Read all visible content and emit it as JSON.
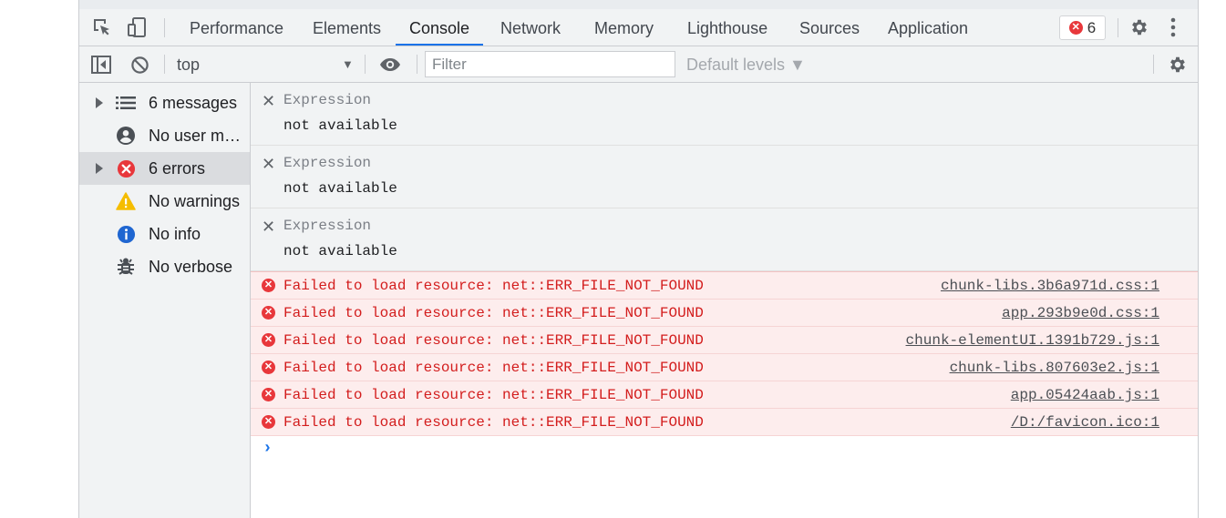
{
  "tabs": [
    {
      "label": "Performance"
    },
    {
      "label": "Elements"
    },
    {
      "label": "Console"
    },
    {
      "label": "Network"
    },
    {
      "label": "Memory"
    },
    {
      "label": "Lighthouse"
    },
    {
      "label": "Sources"
    },
    {
      "label": "Application"
    }
  ],
  "header": {
    "error_count": "6",
    "inspect_icon": "inspect-element-icon",
    "device_icon": "device-toolbar-icon",
    "settings_icon": "gear-icon",
    "more_icon": "kebab-menu-icon"
  },
  "toolbar": {
    "context": "top",
    "filter_placeholder": "Filter",
    "levels": "Default levels ▼"
  },
  "sidebar": {
    "items": [
      {
        "label": "6 messages",
        "icon": "list-icon",
        "expandable": true
      },
      {
        "label": "No user me...",
        "icon": "user-icon",
        "expandable": false
      },
      {
        "label": "6 errors",
        "icon": "error-icon",
        "expandable": true,
        "selected": true
      },
      {
        "label": "No warnings",
        "icon": "warning-icon",
        "expandable": false
      },
      {
        "label": "No info",
        "icon": "info-icon",
        "expandable": false
      },
      {
        "label": "No verbose",
        "icon": "bug-icon",
        "expandable": false
      }
    ]
  },
  "expressions": [
    {
      "name": "Expression",
      "value": "not available"
    },
    {
      "name": "Expression",
      "value": "not available"
    },
    {
      "name": "Expression",
      "value": "not available"
    }
  ],
  "errors": [
    {
      "message": "Failed to load resource: net::ERR_FILE_NOT_FOUND",
      "source": "chunk-libs.3b6a971d.css:1"
    },
    {
      "message": "Failed to load resource: net::ERR_FILE_NOT_FOUND",
      "source": "app.293b9e0d.css:1"
    },
    {
      "message": "Failed to load resource: net::ERR_FILE_NOT_FOUND",
      "source": "chunk-elementUI.1391b729.js:1"
    },
    {
      "message": "Failed to load resource: net::ERR_FILE_NOT_FOUND",
      "source": "chunk-libs.807603e2.js:1"
    },
    {
      "message": "Failed to load resource: net::ERR_FILE_NOT_FOUND",
      "source": "app.05424aab.js:1"
    },
    {
      "message": "Failed to load resource: net::ERR_FILE_NOT_FOUND",
      "source": "/D:/favicon.ico:1"
    }
  ],
  "colors": {
    "accent": "#1a73e8",
    "error_red": "#d31d1d",
    "error_bg": "#fdeded",
    "panel_bg": "#f1f3f4"
  }
}
